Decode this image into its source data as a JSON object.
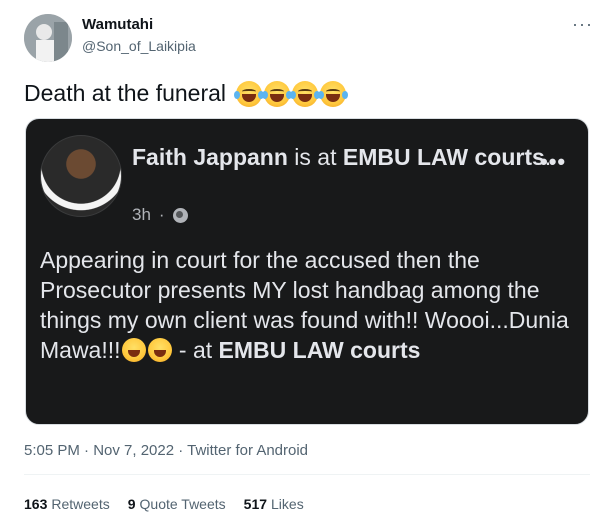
{
  "tweet": {
    "display_name": "Wamutahi",
    "handle": "@Son_of_Laikipia",
    "text": "Death at the funeral",
    "emoji": [
      "laughing-tears",
      "laughing-tears",
      "laughing-tears",
      "laughing-tears"
    ],
    "more_label": "···"
  },
  "embedded_post": {
    "author": "Faith Jappann",
    "is_at": "is at",
    "place": "EMBU LAW courts",
    "place_suffix": ".",
    "time": "3h",
    "dot": "·",
    "body_main": "Appearing in court for the  accused then the Prosecutor presents MY lost handbag among the things my own client was found with!! Woooi...Dunia Mawa!!!",
    "body_at": "- at",
    "body_place": "EMBU LAW courts",
    "menu_label": "•••"
  },
  "footer": {
    "timestamp": "5:05 PM · Nov 7, 2022 · Twitter for Android",
    "retweets_count": "163",
    "retweets_label": "Retweets",
    "quotes_count": "9",
    "quotes_label": "Quote Tweets",
    "likes_count": "517",
    "likes_label": "Likes"
  }
}
